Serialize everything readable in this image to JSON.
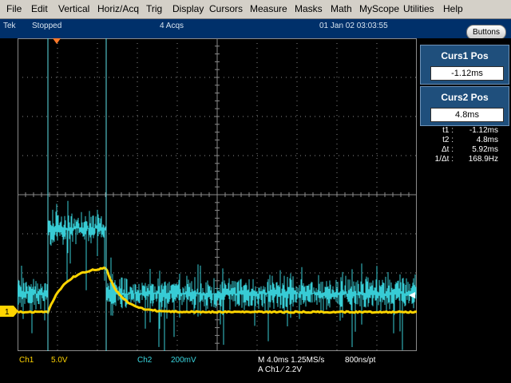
{
  "menu": [
    "File",
    "Edit",
    "Vertical",
    "Horiz/Acq",
    "Trig",
    "Display",
    "Cursors",
    "Measure",
    "Masks",
    "Math",
    "MyScope",
    "Utilities",
    "Help"
  ],
  "status": {
    "brand": "Tek",
    "run_state": "Stopped",
    "acqs": "4 Acqs",
    "datetime": "01 Jan 02 03:03:55",
    "buttons_label": "Buttons"
  },
  "cursors": {
    "curs1_title": "Curs1 Pos",
    "curs1_value": "-1.12ms",
    "curs2_title": "Curs2 Pos",
    "curs2_value": "4.8ms"
  },
  "readout": [
    {
      "label": "t1 :",
      "value": "-1.12ms"
    },
    {
      "label": "t2 :",
      "value": "4.8ms"
    },
    {
      "label": "Δt :",
      "value": "5.92ms"
    },
    {
      "label": "1/Δt :",
      "value": "168.9Hz"
    }
  ],
  "channel_marker": "1",
  "bottom": {
    "ch1_label": "Ch1",
    "ch1_scale": "5.0V",
    "ch2_label": "Ch2",
    "ch2_scale": "200mV",
    "timebase": "M 4.0ms 1.25MS/s",
    "resolution": "800ns/pt",
    "trigger": "A  Ch1  ⁄  2.2V"
  },
  "colors": {
    "background": "#000000",
    "ch1": "#ffd400",
    "ch2": "#3ad7e0",
    "cursor": "#5ee0e8",
    "grid": "#8a8a8a",
    "panel": "#1f4f7c",
    "statusbar": "#00306a"
  }
}
